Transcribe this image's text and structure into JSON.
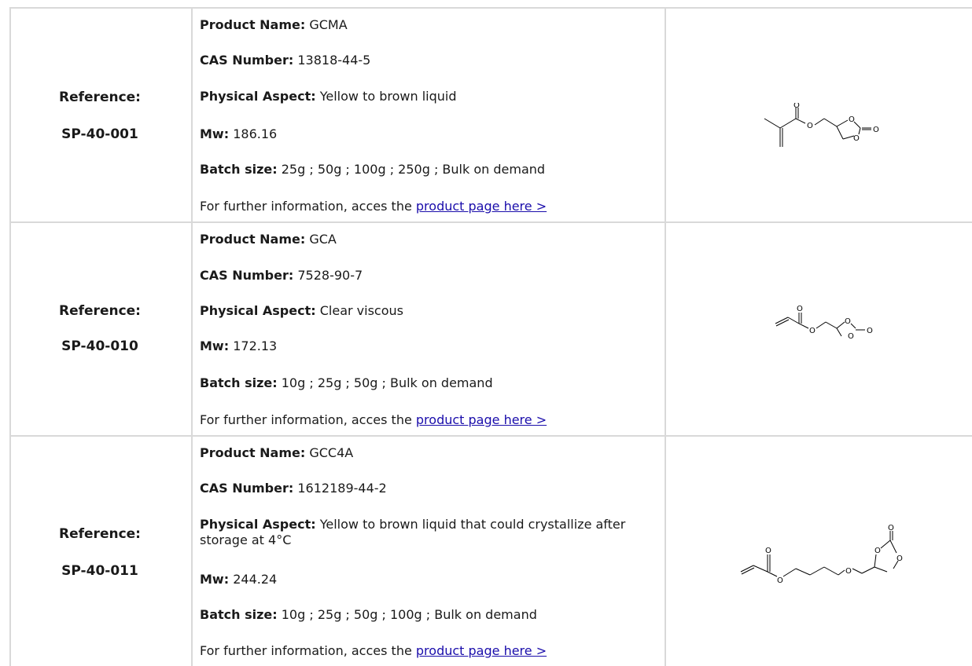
{
  "rows": [
    {
      "reference_label": "Reference:",
      "reference_code": "SP-40-001",
      "product_name_label": "Product Name:",
      "product_name": "GCMA",
      "cas_label": "CAS Number:",
      "cas": "13818-44-5",
      "aspect_label": "Physical Aspect:",
      "aspect": "Yellow to brown liquid",
      "mw_label": "Mw:",
      "mw": "186.16",
      "batch_label": "Batch size:",
      "batch": "25g ; 50g ; 100g ; 250g ; Bulk on demand",
      "info_text": "For further information, acces the ",
      "link_text": "product page here >",
      "structure_icon": "gcma-structure-icon"
    },
    {
      "reference_label": "Reference:",
      "reference_code": "SP-40-010",
      "product_name_label": "Product Name:",
      "product_name": "GCA",
      "cas_label": "CAS Number:",
      "cas": "7528-90-7",
      "aspect_label": "Physical Aspect:",
      "aspect": "Clear viscous",
      "mw_label": "Mw:",
      "mw": "172.13",
      "batch_label": "Batch size:",
      "batch": "10g ; 25g ; 50g ; Bulk on demand",
      "info_text": "For further information, acces the ",
      "link_text": "product page here >",
      "structure_icon": "gca-structure-icon"
    },
    {
      "reference_label": "Reference:",
      "reference_code": "SP-40-011",
      "product_name_label": "Product Name:",
      "product_name": "GCC4A",
      "cas_label": "CAS Number:",
      "cas": "1612189-44-2",
      "aspect_label": "Physical Aspect:",
      "aspect": "Yellow to brown liquid that could crystallize after storage at 4°C",
      "mw_label": "Mw:",
      "mw": "244.24",
      "batch_label": "Batch size:",
      "batch": "10g ; 25g ; 50g ; 100g ; Bulk on demand",
      "info_text": "For further information, acces the ",
      "link_text": "product page here >",
      "structure_icon": "gcc4a-structure-icon"
    }
  ],
  "atom_labels": {
    "oxygen": "O"
  },
  "colors": {
    "border": "#d9d9d9",
    "link": "#1a0dab",
    "text": "#1a1a1a"
  }
}
